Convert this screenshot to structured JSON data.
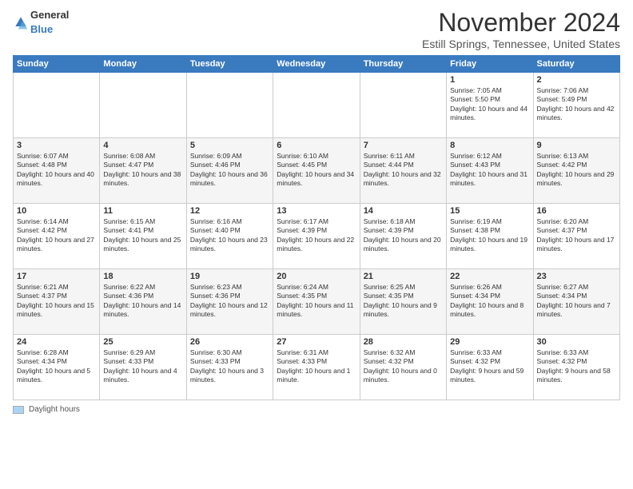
{
  "logo": {
    "general": "General",
    "blue": "Blue"
  },
  "header": {
    "month": "November 2024",
    "location": "Estill Springs, Tennessee, United States"
  },
  "weekdays": [
    "Sunday",
    "Monday",
    "Tuesday",
    "Wednesday",
    "Thursday",
    "Friday",
    "Saturday"
  ],
  "legend": {
    "label": "Daylight hours"
  },
  "weeks": [
    [
      {
        "day": "",
        "info": ""
      },
      {
        "day": "",
        "info": ""
      },
      {
        "day": "",
        "info": ""
      },
      {
        "day": "",
        "info": ""
      },
      {
        "day": "",
        "info": ""
      },
      {
        "day": "1",
        "info": "Sunrise: 7:05 AM\nSunset: 5:50 PM\nDaylight: 10 hours and 44 minutes."
      },
      {
        "day": "2",
        "info": "Sunrise: 7:06 AM\nSunset: 5:49 PM\nDaylight: 10 hours and 42 minutes."
      }
    ],
    [
      {
        "day": "3",
        "info": "Sunrise: 6:07 AM\nSunset: 4:48 PM\nDaylight: 10 hours and 40 minutes."
      },
      {
        "day": "4",
        "info": "Sunrise: 6:08 AM\nSunset: 4:47 PM\nDaylight: 10 hours and 38 minutes."
      },
      {
        "day": "5",
        "info": "Sunrise: 6:09 AM\nSunset: 4:46 PM\nDaylight: 10 hours and 36 minutes."
      },
      {
        "day": "6",
        "info": "Sunrise: 6:10 AM\nSunset: 4:45 PM\nDaylight: 10 hours and 34 minutes."
      },
      {
        "day": "7",
        "info": "Sunrise: 6:11 AM\nSunset: 4:44 PM\nDaylight: 10 hours and 32 minutes."
      },
      {
        "day": "8",
        "info": "Sunrise: 6:12 AM\nSunset: 4:43 PM\nDaylight: 10 hours and 31 minutes."
      },
      {
        "day": "9",
        "info": "Sunrise: 6:13 AM\nSunset: 4:42 PM\nDaylight: 10 hours and 29 minutes."
      }
    ],
    [
      {
        "day": "10",
        "info": "Sunrise: 6:14 AM\nSunset: 4:42 PM\nDaylight: 10 hours and 27 minutes."
      },
      {
        "day": "11",
        "info": "Sunrise: 6:15 AM\nSunset: 4:41 PM\nDaylight: 10 hours and 25 minutes."
      },
      {
        "day": "12",
        "info": "Sunrise: 6:16 AM\nSunset: 4:40 PM\nDaylight: 10 hours and 23 minutes."
      },
      {
        "day": "13",
        "info": "Sunrise: 6:17 AM\nSunset: 4:39 PM\nDaylight: 10 hours and 22 minutes."
      },
      {
        "day": "14",
        "info": "Sunrise: 6:18 AM\nSunset: 4:39 PM\nDaylight: 10 hours and 20 minutes."
      },
      {
        "day": "15",
        "info": "Sunrise: 6:19 AM\nSunset: 4:38 PM\nDaylight: 10 hours and 19 minutes."
      },
      {
        "day": "16",
        "info": "Sunrise: 6:20 AM\nSunset: 4:37 PM\nDaylight: 10 hours and 17 minutes."
      }
    ],
    [
      {
        "day": "17",
        "info": "Sunrise: 6:21 AM\nSunset: 4:37 PM\nDaylight: 10 hours and 15 minutes."
      },
      {
        "day": "18",
        "info": "Sunrise: 6:22 AM\nSunset: 4:36 PM\nDaylight: 10 hours and 14 minutes."
      },
      {
        "day": "19",
        "info": "Sunrise: 6:23 AM\nSunset: 4:36 PM\nDaylight: 10 hours and 12 minutes."
      },
      {
        "day": "20",
        "info": "Sunrise: 6:24 AM\nSunset: 4:35 PM\nDaylight: 10 hours and 11 minutes."
      },
      {
        "day": "21",
        "info": "Sunrise: 6:25 AM\nSunset: 4:35 PM\nDaylight: 10 hours and 9 minutes."
      },
      {
        "day": "22",
        "info": "Sunrise: 6:26 AM\nSunset: 4:34 PM\nDaylight: 10 hours and 8 minutes."
      },
      {
        "day": "23",
        "info": "Sunrise: 6:27 AM\nSunset: 4:34 PM\nDaylight: 10 hours and 7 minutes."
      }
    ],
    [
      {
        "day": "24",
        "info": "Sunrise: 6:28 AM\nSunset: 4:34 PM\nDaylight: 10 hours and 5 minutes."
      },
      {
        "day": "25",
        "info": "Sunrise: 6:29 AM\nSunset: 4:33 PM\nDaylight: 10 hours and 4 minutes."
      },
      {
        "day": "26",
        "info": "Sunrise: 6:30 AM\nSunset: 4:33 PM\nDaylight: 10 hours and 3 minutes."
      },
      {
        "day": "27",
        "info": "Sunrise: 6:31 AM\nSunset: 4:33 PM\nDaylight: 10 hours and 1 minute."
      },
      {
        "day": "28",
        "info": "Sunrise: 6:32 AM\nSunset: 4:32 PM\nDaylight: 10 hours and 0 minutes."
      },
      {
        "day": "29",
        "info": "Sunrise: 6:33 AM\nSunset: 4:32 PM\nDaylight: 9 hours and 59 minutes."
      },
      {
        "day": "30",
        "info": "Sunrise: 6:33 AM\nSunset: 4:32 PM\nDaylight: 9 hours and 58 minutes."
      }
    ]
  ]
}
